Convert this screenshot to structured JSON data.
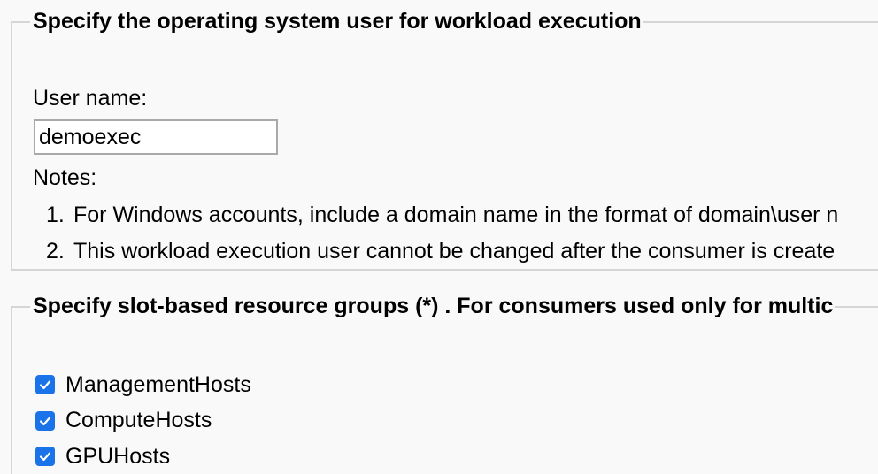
{
  "os_user_section": {
    "legend": "Specify the operating system user for workload execution",
    "user_name_label": "User name:",
    "user_name_value": "demoexec",
    "notes_label": "Notes:",
    "notes": [
      {
        "num": "1.",
        "text": "For Windows accounts, include a domain name in the format of domain\\user n"
      },
      {
        "num": "2.",
        "text": "This workload execution user cannot be changed after the consumer is create"
      }
    ]
  },
  "resource_groups_section": {
    "legend": "Specify slot-based resource groups (*) . For consumers used only for multic",
    "groups": [
      {
        "label": "ManagementHosts",
        "checked": true
      },
      {
        "label": "ComputeHosts",
        "checked": true
      },
      {
        "label": "GPUHosts",
        "checked": true
      }
    ]
  },
  "colors": {
    "checkbox_accent": "#1a73e8",
    "border": "#d6d6d6",
    "background": "#f9f9f9"
  },
  "icons": {
    "checkbox_checked": "checkmark-icon"
  }
}
